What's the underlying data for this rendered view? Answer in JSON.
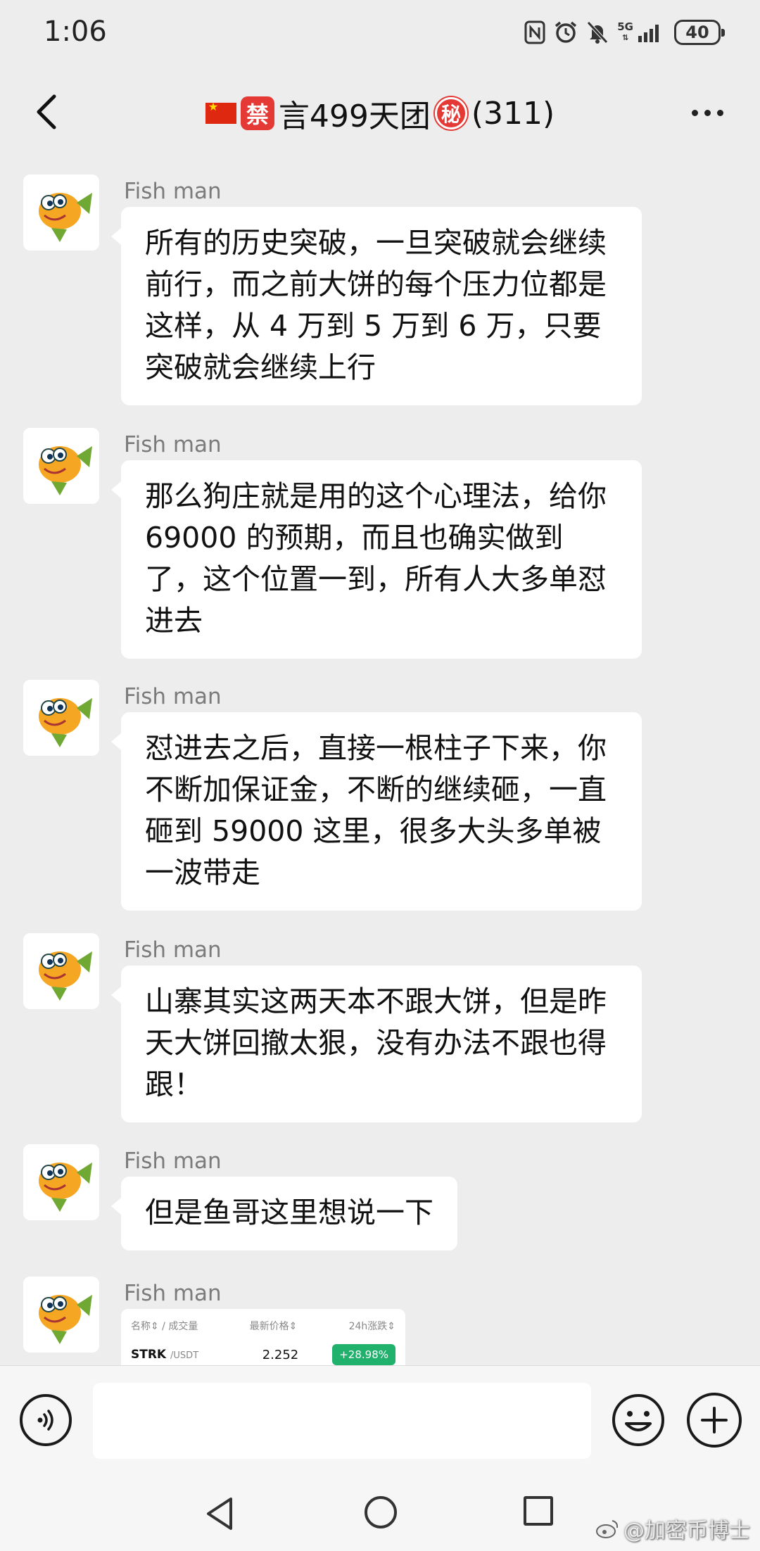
{
  "status_bar": {
    "time": "1:06",
    "network": "5G",
    "battery": "40"
  },
  "header": {
    "title_prefix": "禁",
    "title_main": "言499天团",
    "title_badge": "秘",
    "member_count": "(311)"
  },
  "messages": [
    {
      "sender": "Fish man",
      "text": "所有的历史突破，一旦突破就会继续前行，而之前大饼的每个压力位都是这样，从 4 万到 5 万到 6 万，只要突破就会继续上行"
    },
    {
      "sender": "Fish man",
      "text": "那么狗庄就是用的这个心理法，给你 69000 的预期，而且也确实做到了，这个位置一到，所有人大多单怼进去"
    },
    {
      "sender": "Fish man",
      "text": "怼进去之后，直接一根柱子下来，你不断加保证金，不断的继续砸，一直砸到 59000 这里，很多大头多单被一波带走"
    },
    {
      "sender": "Fish man",
      "text": "山寨其实这两天本不跟大饼，但是昨天大饼回撤太狠，没有办法不跟也得跟！"
    },
    {
      "sender": "Fish man",
      "text": "但是鱼哥这里想说一下"
    },
    {
      "sender": "Fish man",
      "text": ""
    }
  ],
  "market_card": {
    "col_name": "名称⇕ / 成交量",
    "col_price": "最新价格⇕",
    "col_change": "24h涨跌⇕",
    "symbol": "STRK",
    "quote": "/USDT",
    "price": "2.252",
    "change": "+28.98%"
  },
  "input": {
    "placeholder": ""
  },
  "watermark": "@加密币博士",
  "colors": {
    "background": "#ededed",
    "bubble": "#ffffff",
    "badge_red": "#e53935",
    "positive_green": "#20b26c"
  }
}
